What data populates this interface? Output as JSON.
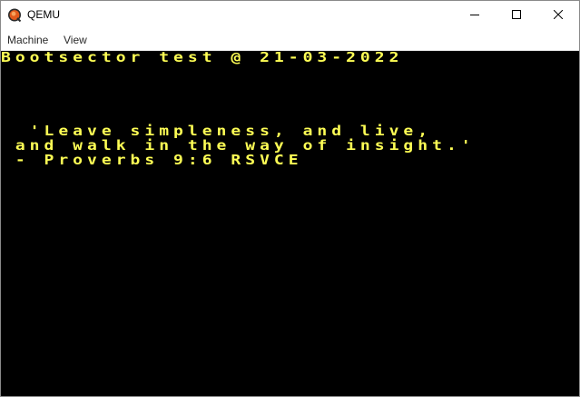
{
  "window": {
    "title": "QEMU",
    "controls": {
      "minimize_icon": "minimize-icon",
      "maximize_icon": "maximize-icon",
      "close_icon": "close-icon"
    }
  },
  "menu": {
    "items": [
      {
        "label": "Machine"
      },
      {
        "label": "View"
      }
    ]
  },
  "screen": {
    "background": "#000000",
    "text_color": "#ffff55",
    "lines": [
      "Bootsector test @ 21-03-2022",
      "  'Leave simpleness, and live,",
      " and walk in the way of insight.'",
      " - Proverbs 9:6 RSVCE"
    ]
  }
}
